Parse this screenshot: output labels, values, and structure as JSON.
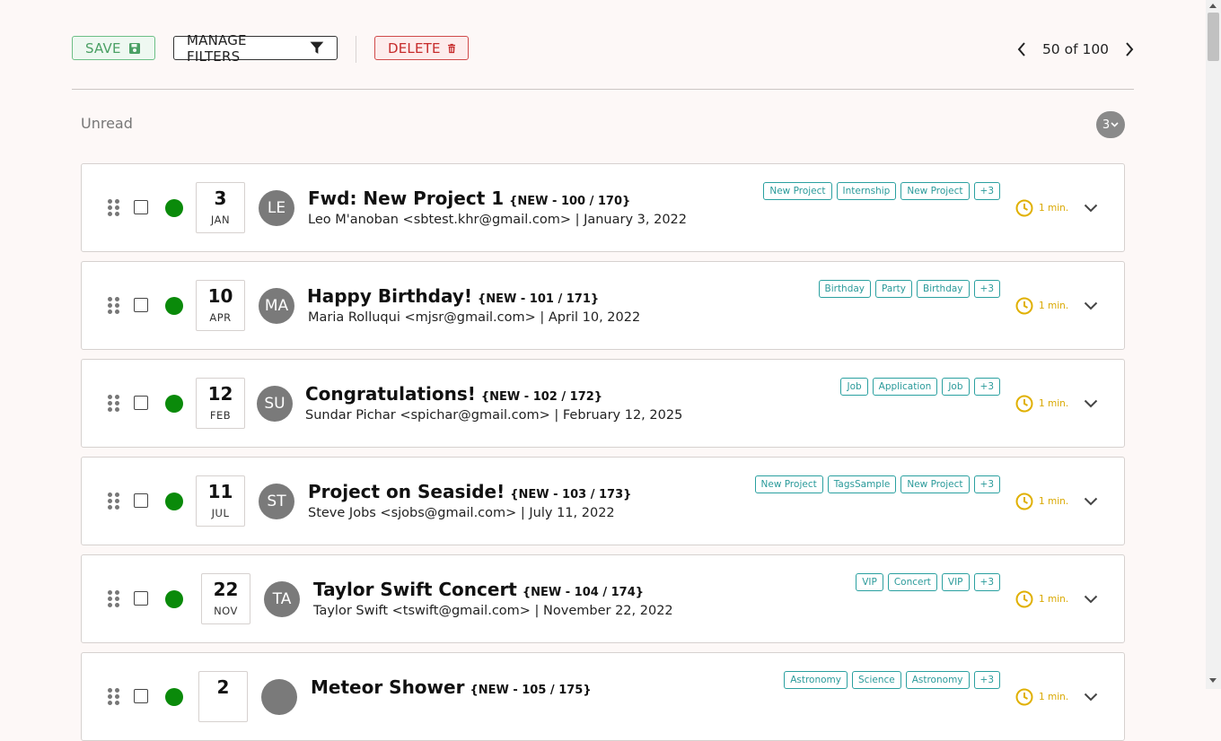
{
  "toolbar": {
    "save_label": "SAVE",
    "save_icon": "floppy-disk-icon",
    "filters_label": "MANAGE FILTERS",
    "filters_icon": "filter-funnel-icon",
    "delete_label": "DELETE",
    "delete_icon": "trash-icon",
    "pager_text": "50 of 100"
  },
  "section": {
    "title": "Unread",
    "count": "3"
  },
  "colors": {
    "save": "#4aa064",
    "delete": "#c62b2b",
    "status_dot": "#0a8a0a",
    "tag": "#2a9a9a",
    "timer": "#d9a800",
    "avatar": "#7a7a7a"
  },
  "emails": [
    {
      "day": "3",
      "month": "JAN",
      "initials": "LE",
      "subject": "Fwd: New Project 1",
      "meta": "{NEW - 100 / 170}",
      "from": "Leo M'anoban <sbtest.khr@gmail.com> | January 3, 2022",
      "tags": [
        "New Project",
        "Internship",
        "New Project",
        "+3"
      ],
      "time": "1 min."
    },
    {
      "day": "10",
      "month": "APR",
      "initials": "MA",
      "subject": "Happy Birthday!",
      "meta": "{NEW - 101 / 171}",
      "from": "Maria Rolluqui <mjsr@gmail.com> | April 10, 2022",
      "tags": [
        "Birthday",
        "Party",
        "Birthday",
        "+3"
      ],
      "time": "1 min."
    },
    {
      "day": "12",
      "month": "FEB",
      "initials": "SU",
      "subject": "Congratulations!",
      "meta": "{NEW - 102 / 172}",
      "from": "Sundar Pichar <spichar@gmail.com> | February 12, 2025",
      "tags": [
        "Job",
        "Application",
        "Job",
        "+3"
      ],
      "time": "1 min."
    },
    {
      "day": "11",
      "month": "JUL",
      "initials": "ST",
      "subject": "Project on Seaside!",
      "meta": "{NEW - 103 / 173}",
      "from": "Steve Jobs <sjobs@gmail.com> | July 11, 2022",
      "tags": [
        "New Project",
        "TagsSample",
        "New Project",
        "+3"
      ],
      "time": "1 min."
    },
    {
      "day": "22",
      "month": "NOV",
      "initials": "TA",
      "subject": "Taylor Swift Concert",
      "meta": "{NEW - 104 / 174}",
      "from": "Taylor Swift <tswift@gmail.com> | November 22, 2022",
      "tags": [
        "VIP",
        "Concert",
        "VIP",
        "+3"
      ],
      "time": "1 min."
    },
    {
      "day": "2",
      "month": "",
      "initials": "",
      "subject": "Meteor Shower",
      "meta": "{NEW - 105 / 175}",
      "from": "",
      "tags": [
        "Astronomy",
        "Science",
        "Astronomy",
        "+3"
      ],
      "time": "1 min."
    }
  ]
}
